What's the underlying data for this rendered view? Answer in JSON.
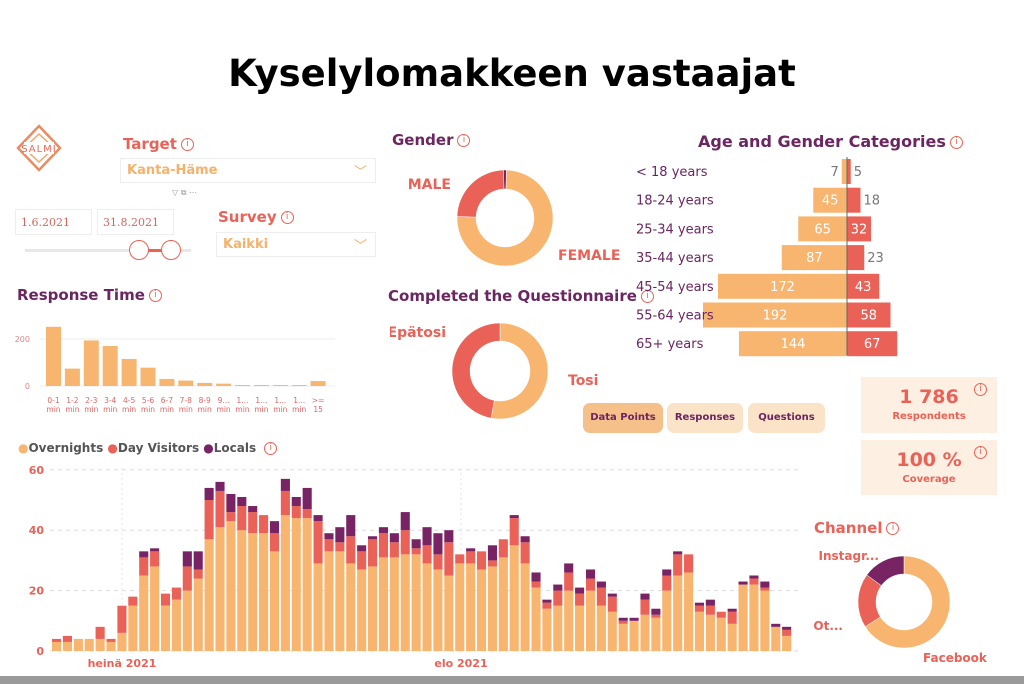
{
  "title": "Kyselylomakkeen vastaajat",
  "logo_text": "SALMI",
  "colors": {
    "orange": "#f7b56f",
    "red": "#ea6257",
    "purple": "#782363",
    "heading_purple": "#6b2560"
  },
  "target": {
    "label": "Target",
    "value": "Kanta-Häme"
  },
  "survey": {
    "label": "Survey",
    "value": "Kaikki"
  },
  "date_range": {
    "start": "1.6.2021",
    "end": "31.8.2021"
  },
  "gender": {
    "title": "Gender",
    "slices": [
      {
        "label": "FEMALE",
        "value": 75
      },
      {
        "label": "MALE",
        "value": 24
      },
      {
        "label": "",
        "value": 1
      }
    ]
  },
  "completed": {
    "title": "Completed the Questionnaire",
    "slices": [
      {
        "label": "Tosi",
        "value": 53
      },
      {
        "label": "Epätosi",
        "value": 47
      }
    ]
  },
  "buttons": [
    "Data Points",
    "Responses",
    "Questions"
  ],
  "kpis": [
    {
      "value": "1 786",
      "label": "Respondents"
    },
    {
      "value": "100 %",
      "label": "Coverage"
    }
  ],
  "channel": {
    "title": "Channel",
    "slices": [
      {
        "label": "Facebook",
        "value": 66
      },
      {
        "label": "Ot...",
        "value": 19
      },
      {
        "label": "Instagr...",
        "value": 15
      }
    ]
  },
  "chart_data": [
    {
      "type": "bar",
      "title": "Response Time",
      "categories": [
        "0-1 min",
        "1-2 min",
        "2-3 min",
        "3-4 min",
        "4-5 min",
        "5-6 min",
        "6-7 min",
        "7-8 min",
        "8-9 min",
        "9... min",
        "1... min",
        "1... min",
        "1... min",
        "1... min",
        ">= 15"
      ],
      "values": [
        252,
        74,
        194,
        170,
        115,
        78,
        30,
        23,
        13,
        10,
        4,
        4,
        4,
        4,
        21
      ],
      "yticks": [
        0,
        200
      ],
      "ylim": [
        0,
        260
      ]
    },
    {
      "type": "bar",
      "orientation": "horizontal-diverging",
      "title": "Age and Gender Categories",
      "categories": [
        "< 18 years",
        "18-24 years",
        "25-34 years",
        "35-44 years",
        "45-54 years",
        "55-64 years",
        "65+ years"
      ],
      "series": [
        {
          "values": [
            7,
            45,
            65,
            87,
            172,
            192,
            144
          ]
        },
        {
          "values": [
            5,
            18,
            32,
            23,
            43,
            58,
            67
          ]
        }
      ]
    },
    {
      "type": "bar",
      "stacked": true,
      "legend": "top-left",
      "yticks": [
        0,
        20,
        40,
        60
      ],
      "ylim": [
        0,
        60
      ],
      "xlabels": [
        "heinä 2021",
        "elo 2021"
      ],
      "series": [
        {
          "name": "Overnights",
          "values": [
            3,
            3,
            4,
            4,
            4,
            3,
            6,
            15,
            25,
            28,
            15,
            17,
            20,
            24,
            37,
            41,
            43,
            40,
            39,
            39,
            33,
            45,
            44,
            44,
            29,
            33,
            33,
            29,
            27,
            28,
            31,
            31,
            32,
            32,
            29,
            27,
            25,
            29,
            29,
            27,
            28,
            31,
            35,
            29,
            21,
            14,
            15,
            20,
            15,
            20,
            15,
            13,
            9,
            10,
            12,
            11,
            20,
            25,
            26,
            13,
            12,
            11,
            9,
            22,
            22,
            20,
            8,
            5
          ]
        },
        {
          "name": "Day Visitors",
          "values": [
            1,
            2,
            0,
            0,
            4,
            1,
            9,
            3,
            6,
            5,
            4,
            4,
            8,
            3,
            13,
            12,
            3,
            8,
            7,
            6,
            6,
            8,
            4,
            3,
            14,
            4,
            3,
            9,
            6,
            9,
            8,
            5,
            8,
            2,
            6,
            5,
            11,
            3,
            4,
            6,
            2,
            6,
            9,
            7,
            2,
            2,
            5,
            6,
            4,
            4,
            6,
            5,
            1,
            0,
            5,
            1,
            5,
            7,
            6,
            2,
            3,
            2,
            4,
            0,
            2,
            1,
            0,
            2
          ]
        },
        {
          "name": "Locals",
          "values": [
            0,
            0,
            0,
            0,
            0,
            0,
            0,
            0,
            2,
            1,
            0,
            0,
            5,
            6,
            4,
            3,
            6,
            3,
            2,
            0,
            4,
            4,
            3,
            7,
            2,
            2,
            5,
            7,
            2,
            1,
            2,
            3,
            6,
            3,
            6,
            7,
            4,
            0,
            1,
            0,
            5,
            0,
            1,
            2,
            3,
            1,
            2,
            3,
            2,
            3,
            2,
            1,
            1,
            1,
            2,
            2,
            2,
            1,
            0,
            1,
            2,
            0,
            1,
            1,
            1,
            2,
            1,
            1
          ]
        }
      ]
    }
  ]
}
